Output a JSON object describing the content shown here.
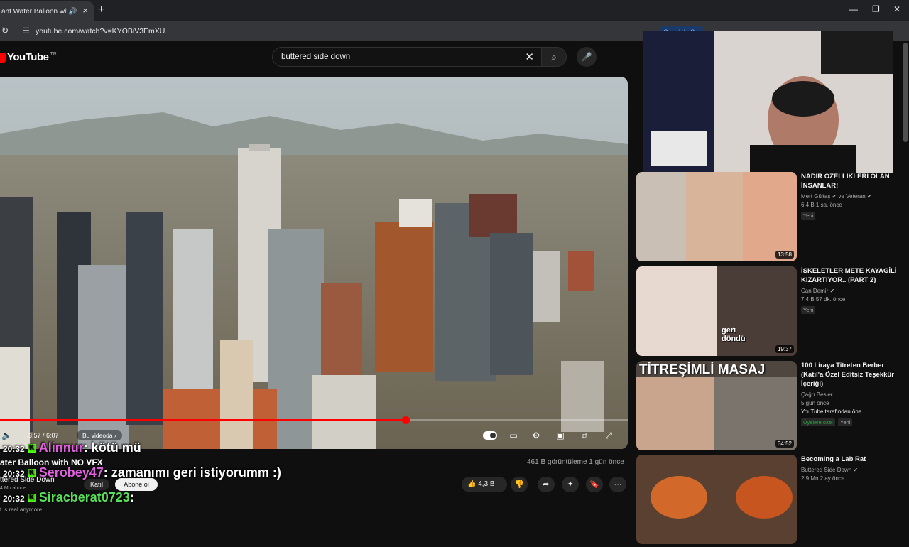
{
  "browser": {
    "tab_title": "ant Water Balloon with N",
    "url": "youtube.com/watch?v=KYOBiV3EmXU",
    "google_button": "Google'a Sor"
  },
  "youtube": {
    "logo_text": "YouTube",
    "country_code": "TR",
    "search_query": "buttered side down"
  },
  "player": {
    "time": "3:57 / 6:07",
    "progress": 0.646,
    "chapter_chip": "Bu videoda ›"
  },
  "video": {
    "title": "ater Balloon with NO VFX",
    "channel": "ttered Side Down",
    "subscribers": "4 Mn abone",
    "join_label": "Katıl",
    "subscribe_label": "Abone ol",
    "views": "461 B görüntüleme  1 gün önce",
    "likes": "4,3 B",
    "desc_line": "t is real anymore"
  },
  "chat": [
    {
      "time": "20:32",
      "name": "Alinnur",
      "msg": ": kötü mü"
    },
    {
      "time": "20:32",
      "name": "Serobey47",
      "msg": ": zamanımı geri istiyorumm :)"
    },
    {
      "time": "20:32",
      "name": "Siracberat0723",
      "msg": ":"
    }
  ],
  "recommendations": [
    {
      "title": "NADIR ÖZELLİKLERİ OLAN İNSANLAR!",
      "channel": "Mert Gültaş ✔ ve Veteran ✔",
      "meta": "6,4 B  1 sa. önce",
      "badge": "Yeni",
      "duration": "13:58"
    },
    {
      "title": "İSKELETLER METE KAYAGİLİ KIZARTIYOR.. (PART 2)",
      "channel": "Can Demir ✔",
      "meta": "7,4 B  57 dk. önce",
      "badge": "Yeni",
      "duration": "19:37",
      "overlay": "geri döndü"
    },
    {
      "title": "100 Liraya Titreten Berber (Katıl'a Özel Editsiz Teşekkür İçeriği)",
      "channel": "Çağrı Besler",
      "meta": "5 gün önce",
      "meta2": "YouTube tarafından öne...",
      "badge": "Üyelere özel",
      "badge2": "Yeni",
      "duration": "34:52",
      "overlay": "TİTREŞİMLİ MASAJ"
    },
    {
      "title": "Becoming a Lab Rat",
      "channel": "Buttered Side Down ✔",
      "meta": "2,9 Mn  2 ay önce"
    }
  ]
}
